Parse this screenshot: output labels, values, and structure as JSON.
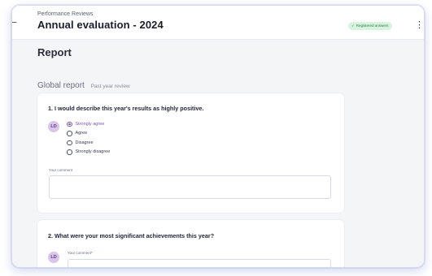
{
  "header": {
    "breadcrumb": "Performance Reviews",
    "title": "Annual evaluation - 2024",
    "status_badge": "Registered answers",
    "back_icon": "arrow-left-icon",
    "menu_icon": "kebab-menu-icon"
  },
  "page": {
    "title": "Report"
  },
  "section": {
    "title": "Global report",
    "subtitle": "Past year review"
  },
  "questions": [
    {
      "text": "1. I would describe this year's results as highly positive.",
      "avatar_initials": "LD",
      "options": [
        "Strongly agree",
        "Agree",
        "Disagree",
        "Strongly disagree"
      ],
      "selected": "Strongly agree",
      "comment_label": "Your comment",
      "comment_value": ""
    },
    {
      "text": "2. What were your most significant achievements this year?",
      "avatar_initials": "LD",
      "comment_label": "Your comment",
      "required_marker": "*",
      "comment_value": ""
    }
  ],
  "colors": {
    "accent": "#7a54ad",
    "badge_bg": "#d8f3df",
    "badge_text": "#2f7d49",
    "frame_glow": "#6a80e0"
  }
}
